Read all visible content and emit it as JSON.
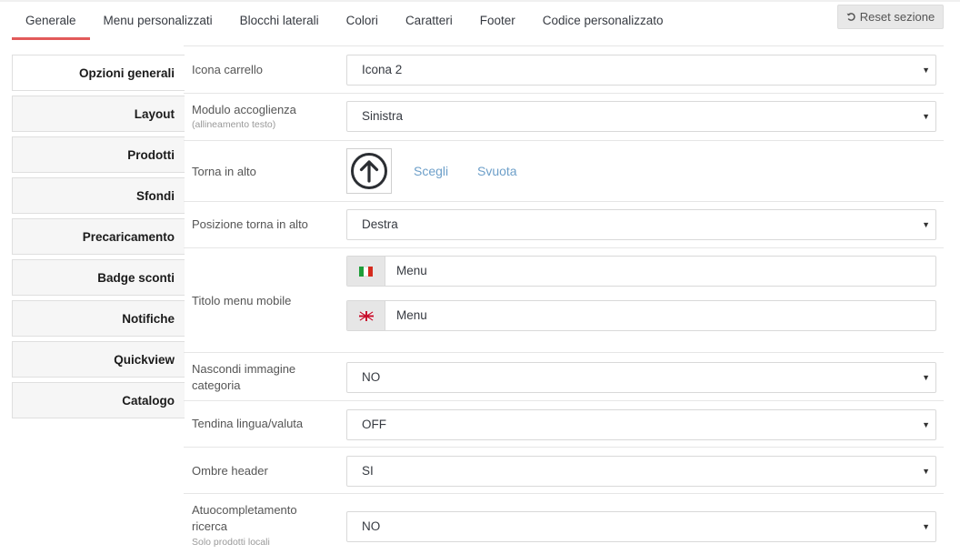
{
  "tabs": [
    {
      "label": "Generale",
      "active": true
    },
    {
      "label": "Menu personalizzati"
    },
    {
      "label": "Blocchi laterali"
    },
    {
      "label": "Colori"
    },
    {
      "label": "Caratteri"
    },
    {
      "label": "Footer"
    },
    {
      "label": "Codice personalizzato"
    }
  ],
  "reset_button": {
    "label": "Reset sezione",
    "icon": "undo-icon"
  },
  "sidebar": {
    "items": [
      {
        "label": "Opzioni generali",
        "active": true
      },
      {
        "label": "Layout"
      },
      {
        "label": "Prodotti"
      },
      {
        "label": "Sfondi"
      },
      {
        "label": "Precaricamento"
      },
      {
        "label": "Badge sconti"
      },
      {
        "label": "Notifiche"
      },
      {
        "label": "Quickview"
      },
      {
        "label": "Catalogo"
      }
    ]
  },
  "form": {
    "cart_icon": {
      "label": "Icona carrello",
      "value": "Icona 2"
    },
    "welcome_module": {
      "label": "Modulo accoglienza",
      "hint": "(allineamento testo)",
      "value": "Sinistra"
    },
    "back_to_top": {
      "label": "Torna in alto",
      "icon": "arrow-up-circle-icon",
      "choose": "Scegli",
      "clear": "Svuota"
    },
    "back_to_top_position": {
      "label": "Posizione torna in alto",
      "value": "Destra"
    },
    "mobile_menu_title": {
      "label": "Titolo menu mobile",
      "languages": [
        {
          "flag": "italy-flag-icon",
          "value": "Menu"
        },
        {
          "flag": "uk-flag-icon",
          "value": "Menu"
        }
      ]
    },
    "hide_category_image": {
      "label": "Nascondi immagine categoria",
      "value": "NO"
    },
    "language_currency_dropdown": {
      "label": "Tendina lingua/valuta",
      "value": "OFF"
    },
    "header_shadows": {
      "label": "Ombre header",
      "value": "SI"
    },
    "search_autocomplete": {
      "label": "Atuocompletamento ricerca",
      "hint": "Solo prodotti locali",
      "value": "NO"
    }
  }
}
